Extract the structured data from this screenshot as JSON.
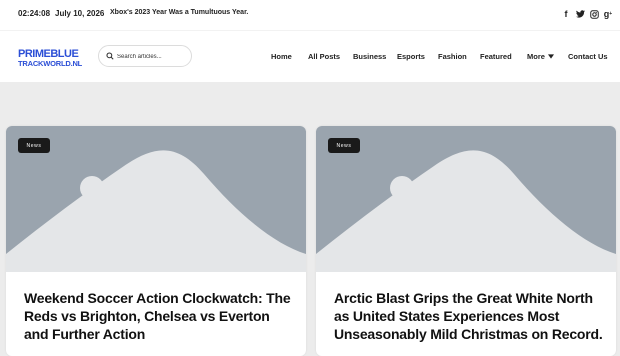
{
  "topbar": {
    "time": "02:24:08",
    "date": "July 10, 2026",
    "ticker": "Xbox's 2023 Year Was a Tumultuous Year.",
    "social": [
      "facebook-icon",
      "twitter-icon",
      "instagram-icon",
      "google-plus-icon"
    ]
  },
  "header": {
    "logo_line1": "PRIMEBLUE",
    "logo_line2": "TRACKWORLD.NL",
    "search_placeholder": "Search articles...",
    "nav": [
      "Home",
      "All Posts",
      "Business",
      "Esports",
      "Fashion",
      "Featured",
      "More",
      "Contact Us"
    ]
  },
  "posts": [
    {
      "category": "News",
      "title": "Weekend Soccer Action Clockwatch: The Reds vs Brighton, Chelsea vs Everton and Further Action"
    },
    {
      "category": "News",
      "title": "Arctic Blast Grips the Great White North as United States Experiences Most Unseasonably Mild Christmas on Record."
    }
  ],
  "colors": {
    "accent": "#2c4fd6",
    "placeholder_bg": "#9aa4ae",
    "placeholder_fg": "#e4e6e8"
  }
}
